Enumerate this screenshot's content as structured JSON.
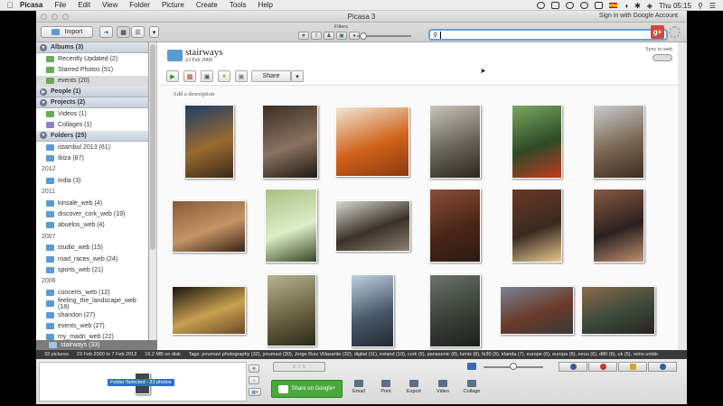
{
  "menubar": {
    "app": "Picasa",
    "items": [
      "File",
      "Edit",
      "View",
      "Folder",
      "Picture",
      "Create",
      "Tools",
      "Help"
    ],
    "clock": "Thu 05:15"
  },
  "window": {
    "title": "Picasa 3",
    "signin": "Sign in with Google Account"
  },
  "toolbar": {
    "import_label": "Import",
    "filters_label": "Filters",
    "search_value": ""
  },
  "sidebar": {
    "sections": {
      "albums": "Albums (3)",
      "people": "People (1)",
      "projects": "Projects (2)",
      "folders": "Folders (25)"
    },
    "albums": [
      {
        "label": "Recently Updated (2)"
      },
      {
        "label": "Starred Photos (51)"
      },
      {
        "label": "events (20)"
      }
    ],
    "projects": [
      {
        "label": "Videos (1)"
      },
      {
        "label": "Collages (1)"
      }
    ],
    "folders_top": [
      {
        "label": "istambul 2013 (61)"
      },
      {
        "label": "ibiza (87)"
      }
    ],
    "year_2012": "2012",
    "folders_2012": [
      {
        "label": "india (3)"
      }
    ],
    "year_2011": "2011",
    "folders_2011": [
      {
        "label": "kinsale_web (4)"
      },
      {
        "label": "discover_cork_web (19)"
      },
      {
        "label": "abuelos_web (4)"
      }
    ],
    "year_2007": "2007",
    "folders_2007": [
      {
        "label": "studio_web (15)"
      },
      {
        "label": "road_races_web (24)"
      },
      {
        "label": "sports_web (21)"
      }
    ],
    "year_2006": "2006",
    "folders_2006": [
      {
        "label": "concerts_web (12)"
      },
      {
        "label": "feeling_the_landscape_web (18)"
      },
      {
        "label": "shandon (27)"
      },
      {
        "label": "events_web (27)"
      },
      {
        "label": "my_madri_web (22)"
      }
    ],
    "selected": "stairways (33)"
  },
  "album": {
    "title": "stairways",
    "date": "23 Feb 2000",
    "sync_label": "Sync to web",
    "share_label": "Share",
    "add_description": "Add a description"
  },
  "photos": [
    {
      "name": "photo-1",
      "colors": [
        "#1e3e66",
        "#9a6a30",
        "#3a2a18"
      ]
    },
    {
      "name": "photo-2",
      "colors": [
        "#3a2e26",
        "#8a7260",
        "#1e1a16"
      ]
    },
    {
      "name": "photo-3",
      "colors": [
        "#f0e8d8",
        "#d0621a",
        "#8a3a10"
      ]
    },
    {
      "name": "photo-4",
      "colors": [
        "#c8c4b8",
        "#6a6458",
        "#2a2620"
      ]
    },
    {
      "name": "photo-5",
      "colors": [
        "#7aa860",
        "#2e4a26",
        "#c03a20"
      ]
    },
    {
      "name": "photo-6",
      "colors": [
        "#c8ccd0",
        "#7a6650",
        "#3a2e24"
      ]
    },
    {
      "name": "photo-7",
      "colors": [
        "#8a5a36",
        "#c49466",
        "#3a2616"
      ]
    },
    {
      "name": "photo-8",
      "colors": [
        "#a8c080",
        "#ddeec8",
        "#3a4426"
      ]
    },
    {
      "name": "photo-9",
      "colors": [
        "#d8d8d0",
        "#3a3228",
        "#8a8070"
      ]
    },
    {
      "name": "photo-10",
      "colors": [
        "#8a4e36",
        "#4a2618",
        "#2a1a12"
      ]
    },
    {
      "name": "photo-11",
      "colors": [
        "#6a3826",
        "#3a2a20",
        "#e8c890"
      ]
    },
    {
      "name": "photo-12",
      "colors": [
        "#8a5a40",
        "#2a2020",
        "#c09070"
      ]
    },
    {
      "name": "photo-13",
      "colors": [
        "#1a1410",
        "#c8a050",
        "#6a4a2a"
      ]
    },
    {
      "name": "photo-14",
      "colors": [
        "#b8b490",
        "#6a6444",
        "#2a2818"
      ]
    },
    {
      "name": "photo-15",
      "colors": [
        "#c0d0e0",
        "#4a5a6a",
        "#202830"
      ]
    },
    {
      "name": "photo-16",
      "colors": [
        "#6a7468",
        "#3a4038",
        "#1c201c"
      ]
    },
    {
      "name": "photo-17",
      "colors": [
        "#7a8494",
        "#6a3a2a",
        "#3a3a3a"
      ]
    },
    {
      "name": "photo-18",
      "colors": [
        "#8a6a4a",
        "#3a4a3a",
        "#2a2420"
      ]
    }
  ],
  "statusbar": {
    "count": "33 pictures",
    "range": "23 Feb 2000 to 7 Feb 2012",
    "size": "16.2 MB on disk",
    "tags": "Tags: jorumavi photography (32), jorumavi (30), Jorge Ruiz Villasante (32), digital (11), ireland (10), cork (9), panasonic (8), lumix (8), fz30 (8), irlanda (7), europe (6), europa (6), eeuu (6), d80 (6), uk (5), reino unido"
  },
  "tray": {
    "folder_selected": "Folder Selected - 33 photos",
    "share_google": "Share on Google+",
    "email": "Email",
    "print": "Print",
    "export": "Export",
    "video": "Video",
    "collage": "Collage"
  },
  "colors": {
    "accent": "#5b9bd5",
    "share_green": "#4aa93b",
    "gplus_red": "#d34836",
    "selected_blue": "#2e6fce"
  }
}
